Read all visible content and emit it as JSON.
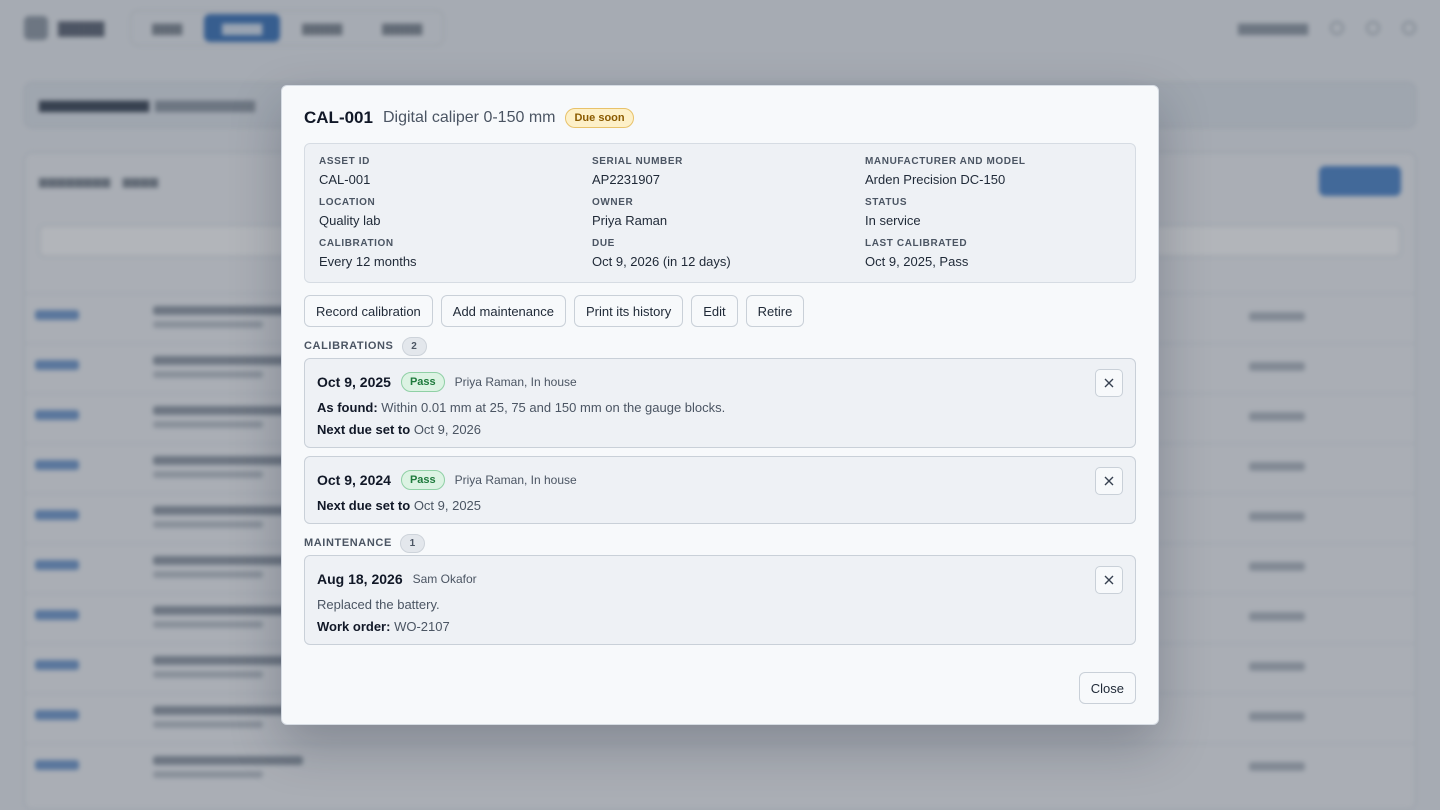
{
  "modal": {
    "asset_code": "CAL-001",
    "asset_name": "Digital caliper 0-150 mm",
    "status_badge": "Due soon",
    "fields": [
      {
        "label": "Asset ID",
        "value": "CAL-001"
      },
      {
        "label": "Serial number",
        "value": "AP2231907"
      },
      {
        "label": "Manufacturer and model",
        "value": "Arden Precision DC-150"
      },
      {
        "label": "Location",
        "value": "Quality lab"
      },
      {
        "label": "Owner",
        "value": "Priya Raman"
      },
      {
        "label": "Status",
        "value": "In service"
      },
      {
        "label": "Calibration",
        "value": "Every 12 months"
      },
      {
        "label": "Due",
        "value": "Oct 9, 2026 (in 12 days)"
      },
      {
        "label": "Last calibrated",
        "value": "Oct 9, 2025, Pass"
      }
    ],
    "actions": {
      "record_calibration": "Record calibration",
      "add_maintenance": "Add maintenance",
      "print_history": "Print its history",
      "edit": "Edit",
      "retire": "Retire"
    },
    "calibrations": {
      "title": "CALIBRATIONS",
      "count": "2",
      "items": [
        {
          "date": "Oct 9, 2025",
          "result": "Pass",
          "by": "Priya Raman, In house",
          "found_label": "As found:",
          "found_value": "Within 0.01 mm at 25, 75 and 150 mm on the gauge blocks.",
          "next_label": "Next due set to",
          "next_value": "Oct 9, 2026"
        },
        {
          "date": "Oct 9, 2024",
          "result": "Pass",
          "by": "Priya Raman, In house",
          "next_label": "Next due set to",
          "next_value": "Oct 9, 2025"
        }
      ]
    },
    "maintenance": {
      "title": "MAINTENANCE",
      "count": "1",
      "items": [
        {
          "date": "Aug 18, 2026",
          "by": "Sam Okafor",
          "note": "Replaced the battery.",
          "wo_label": "Work order:",
          "wo_value": "WO-2107"
        }
      ]
    },
    "close_label": "Close"
  },
  "colors": {
    "due_soon": "#fdf0c8",
    "pass": "#dcf3e3",
    "accent_blurred": "#4a7fc0"
  }
}
